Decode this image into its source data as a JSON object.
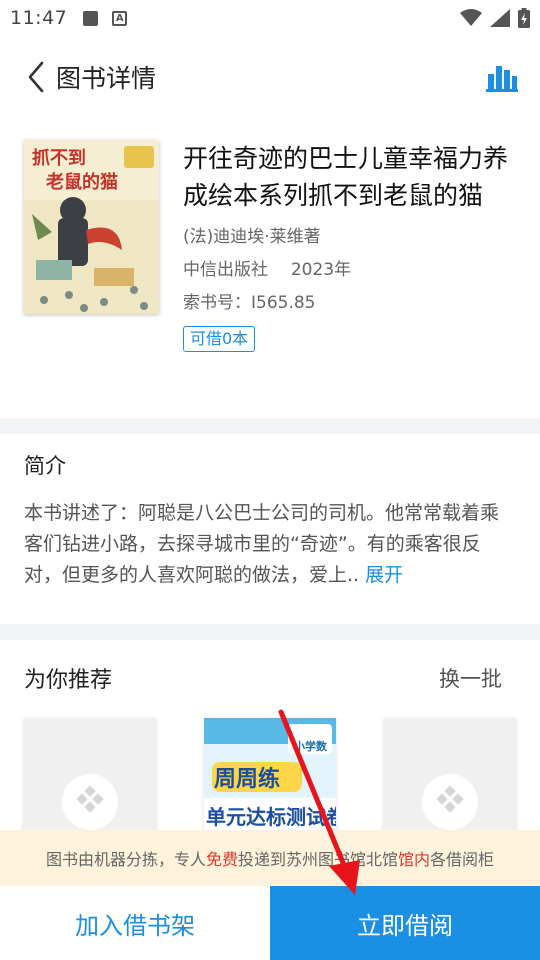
{
  "status_bar": {
    "time": "11:47"
  },
  "nav": {
    "title": "图书详情"
  },
  "book": {
    "cover_title_line1": "抓不到",
    "cover_title_line2": "老鼠的猫",
    "title": "开往奇迹的巴士儿童幸福力养成绘本系列抓不到老鼠的猫",
    "author": "(法)迪迪埃·莱维著",
    "publisher": "中信出版社",
    "year": "2023年",
    "call_number": "索书号：I565.85",
    "available": "可借0本"
  },
  "intro": {
    "heading": "简介",
    "text": "本书讲述了：阿聪是八公巴士公司的司机。他常常载着乘客们钻进小路，去探寻城市里的“奇迹”。有的乘客很反对，但更多的人喜欢阿聪的做法，爱上..",
    "expand": "展开"
  },
  "recommend": {
    "heading": "为你推荐",
    "refresh": "换一批",
    "middle_cover_line1": "周周练",
    "middle_cover_line2": "单元达标测试卷",
    "middle_cover_tag": "小学数"
  },
  "notice": {
    "part1": "图书由机器分拣，专人",
    "highlight1": "免费",
    "part2": "投递到苏州图书馆北馆",
    "highlight2": "馆内",
    "part3": "各借阅柜"
  },
  "actions": {
    "add_shelf": "加入借书架",
    "borrow_now": "立即借阅"
  },
  "colors": {
    "accent": "#1a8fe3",
    "notice_bg": "#fdf3dc",
    "highlight": "#e23a2e",
    "annotation": "#e8141c"
  }
}
